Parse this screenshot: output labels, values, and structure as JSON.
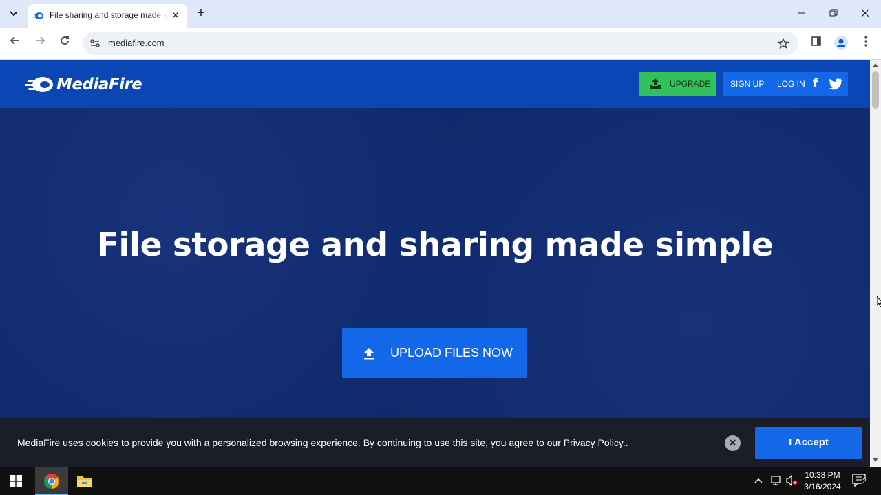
{
  "browser": {
    "tab_title": "File sharing and storage made simple",
    "url": "mediafire.com",
    "new_tab_symbol": "+",
    "close_symbol": "✕"
  },
  "site": {
    "logo_text": "MediaFire",
    "header": {
      "upgrade_label": "UPGRADE",
      "signup_label": "SIGN UP",
      "login_label": "LOG IN",
      "facebook_glyph": "f"
    },
    "hero": {
      "title": "File storage and sharing made simple",
      "upload_label": "UPLOAD FILES NOW"
    },
    "cookie": {
      "text": "MediaFire uses cookies to provide you with a personalized browsing experience. By continuing to use this site, you agree to our Privacy Policy..",
      "accept_label": "I Accept"
    }
  },
  "taskbar": {
    "time": "10:38 PM",
    "date": "3/16/2024",
    "notification_count": "2"
  },
  "colors": {
    "header_blue": "#0a47b5",
    "hero_navy": "#10296d",
    "action_blue": "#1268e8",
    "upgrade_green": "#33c15c",
    "cookie_bg": "#1b1e29"
  },
  "icons": [
    "tab-search-icon",
    "mediafire-favicon",
    "back-icon",
    "forward-icon",
    "reload-icon",
    "site-info-icon",
    "bookmark-star-icon",
    "side-panel-icon",
    "profile-icon",
    "kebab-menu-icon",
    "upgrade-icon",
    "facebook-icon",
    "twitter-icon",
    "upload-icon",
    "close-icon",
    "windows-start-icon",
    "chrome-icon",
    "file-explorer-icon",
    "tray-chevron-icon",
    "network-icon",
    "volume-muted-icon",
    "notification-icon"
  ]
}
